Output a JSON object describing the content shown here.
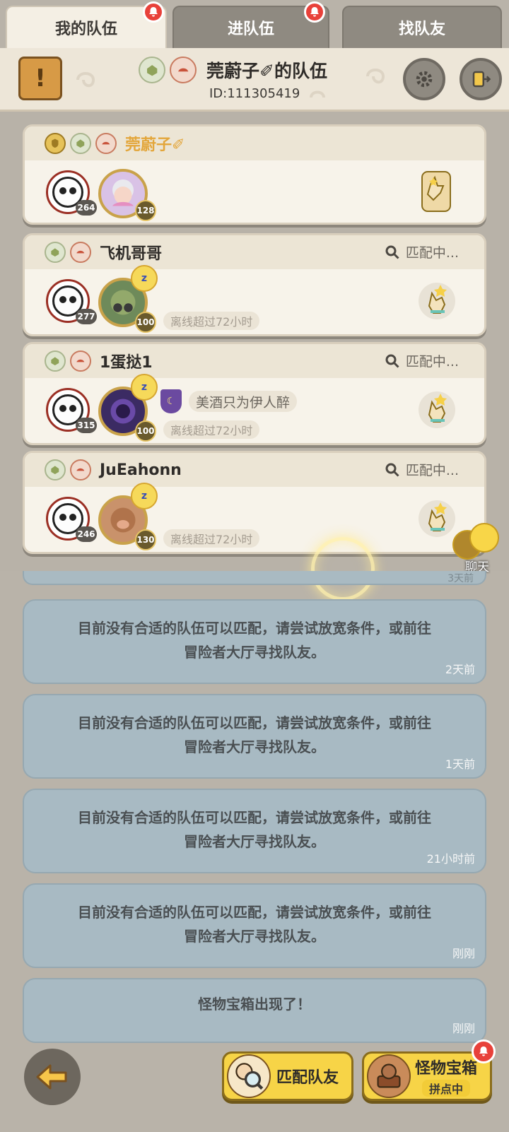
{
  "tabs": [
    {
      "label": "我的队伍",
      "active": true,
      "bell": true
    },
    {
      "label": "进队伍",
      "active": false,
      "bell": true
    },
    {
      "label": "找队友",
      "active": false,
      "bell": false
    }
  ],
  "header": {
    "title": "莞蔚子✐的队伍",
    "team_id": "ID:111305419"
  },
  "members": [
    {
      "name": "莞蔚子✐",
      "is_leader": true,
      "avatar_level": "264",
      "pet_level": "128",
      "matching": "",
      "offline": "",
      "guild": ""
    },
    {
      "name": "飞机哥哥",
      "is_leader": false,
      "avatar_level": "277",
      "pet_level": "100",
      "matching": "匹配中...",
      "offline": "离线超过72小时",
      "guild": ""
    },
    {
      "name": "1蛋挞1",
      "is_leader": false,
      "avatar_level": "315",
      "pet_level": "100",
      "matching": "匹配中...",
      "offline": "离线超过72小时",
      "guild": "美酒只为伊人醉"
    },
    {
      "name": "JuEahonn",
      "is_leader": false,
      "avatar_level": "246",
      "pet_level": "130",
      "matching": "匹配中...",
      "offline": "离线超过72小时",
      "guild": ""
    }
  ],
  "chat": {
    "label": "聊天"
  },
  "messages": {
    "partial_time": "3天前",
    "items": [
      {
        "text_line1": "目前没有合适的队伍可以匹配，请尝试放宽条件，或前往",
        "text_line2": "冒险者大厅寻找队友。",
        "time": "2天前"
      },
      {
        "text_line1": "目前没有合适的队伍可以匹配，请尝试放宽条件，或前往",
        "text_line2": "冒险者大厅寻找队友。",
        "time": "1天前"
      },
      {
        "text_line1": "目前没有合适的队伍可以匹配，请尝试放宽条件，或前往",
        "text_line2": "冒险者大厅寻找队友。",
        "time": "21小时前"
      },
      {
        "text_line1": "目前没有合适的队伍可以匹配，请尝试放宽条件，或前往",
        "text_line2": "冒险者大厅寻找队友。",
        "time": "刚刚"
      },
      {
        "text_line1": "怪物宝箱出现了！",
        "text_line2": "",
        "time": "刚刚"
      }
    ]
  },
  "bottom": {
    "match_label": "匹配队友",
    "chest_label": "怪物宝箱",
    "chest_status": "拼点中"
  },
  "colors": {
    "tab_active": "#f4efe4",
    "tab_inactive": "#8f8a81",
    "message_bg": "#a8bac3",
    "action_yellow": "#f7d447",
    "notify_red": "#e8413a",
    "leader_name": "#e3a63b"
  }
}
